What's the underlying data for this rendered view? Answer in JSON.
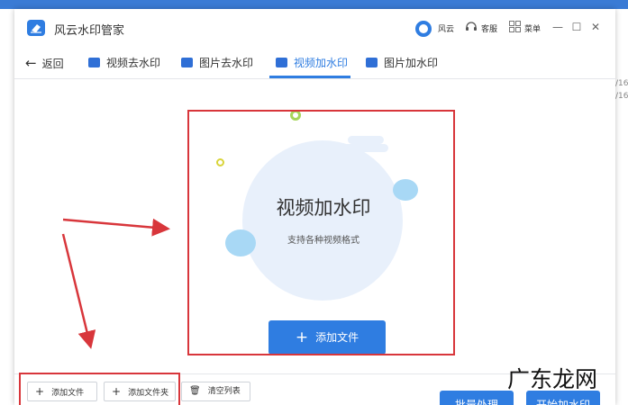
{
  "app": {
    "title": "风云水印管家"
  },
  "titlebar": {
    "brand": "风云",
    "service": "客服",
    "menu": "菜单"
  },
  "nav": {
    "back": "返回",
    "tabs": [
      {
        "label": "视频去水印"
      },
      {
        "label": "图片去水印"
      },
      {
        "label": "视频加水印"
      },
      {
        "label": "图片加水印"
      }
    ]
  },
  "drop": {
    "title": "视频加水印",
    "subtitle": "支持各种视频格式",
    "add_file": "添加文件"
  },
  "toolbar": {
    "add_file": "添加文件",
    "add_folder": "添加文件夹",
    "clear_list": "清空列表",
    "batch": "批量处理",
    "start": "开始加水印"
  },
  "peek": {
    "line1": "/16",
    "line2": "/16"
  },
  "watermark": {
    "text": "广东龙网"
  },
  "colors": {
    "accent": "#2f7de1",
    "annotation": "#d8363b"
  }
}
